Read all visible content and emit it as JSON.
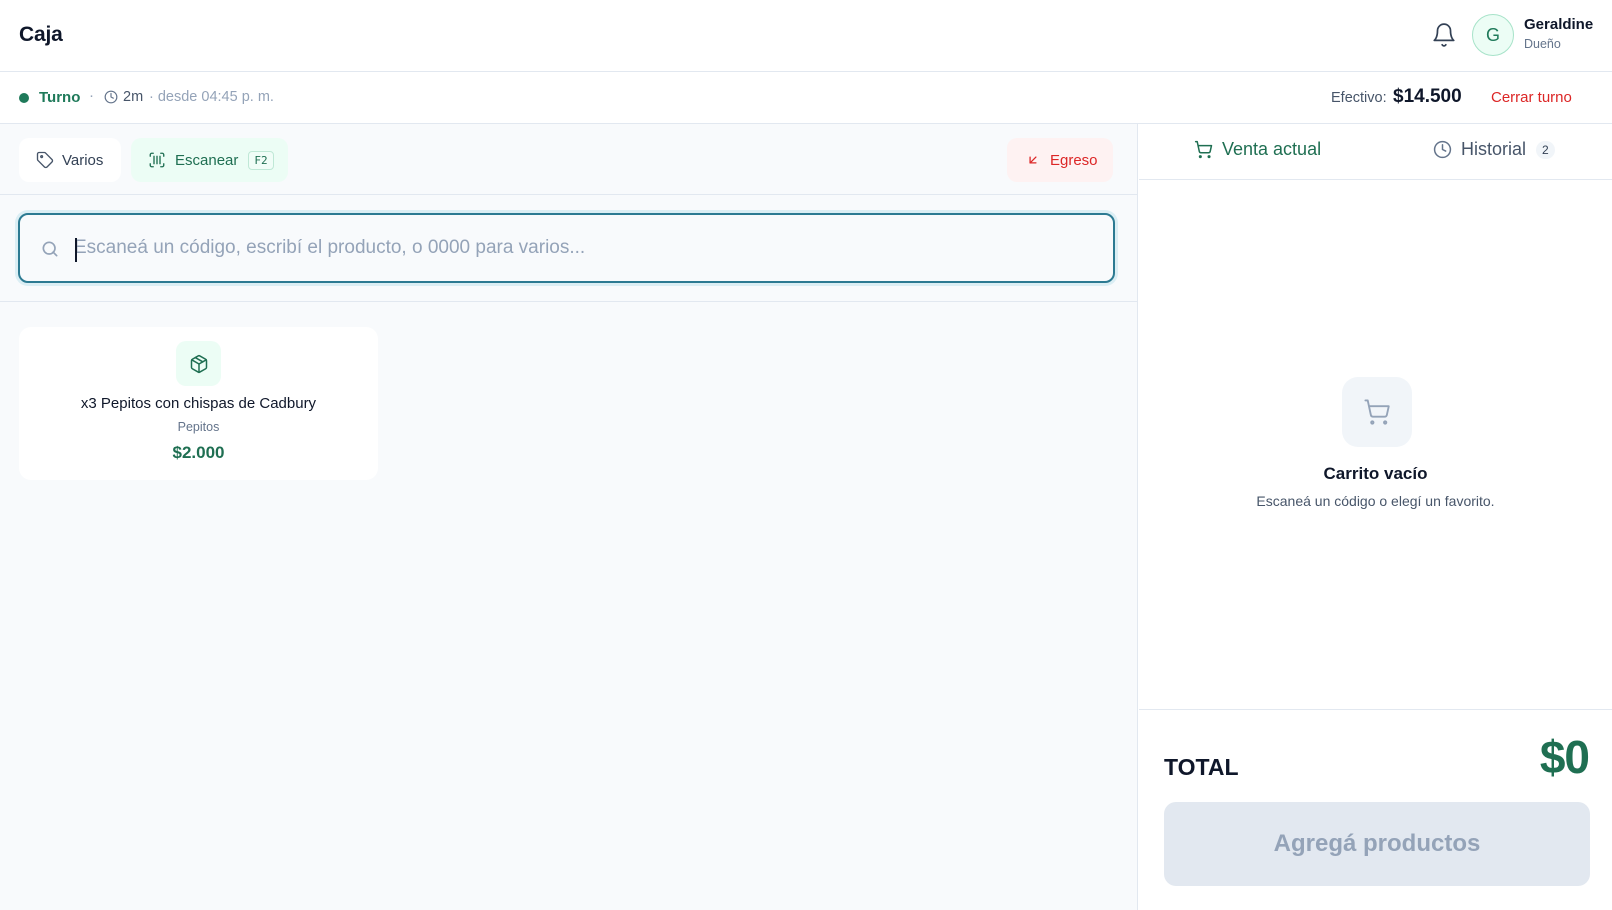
{
  "header": {
    "title": "Caja",
    "user": {
      "initial": "G",
      "name": "Geraldine",
      "role": "Dueño"
    }
  },
  "statusbar": {
    "turno_label": "Turno",
    "separator": "·",
    "elapsed": "2m",
    "since": "· desde 04:45 p. m.",
    "efectivo_label": "Efectivo:",
    "efectivo_value": "$14.500",
    "cerrar_label": "Cerrar turno",
    "status_color": "#1f7a5a"
  },
  "toolbar": {
    "varios_label": "Varios",
    "scan_label": "Escanear",
    "scan_shortcut": "F2",
    "egreso_label": "Egreso"
  },
  "search": {
    "placeholder": "Escaneá un código, escribí el producto, o 0000 para varios...",
    "value": ""
  },
  "products": [
    {
      "name": "x3 Pepitos con chispas de Cadbury",
      "category": "Pepitos",
      "price": "$2.000",
      "icon": "package-icon"
    }
  ],
  "cart": {
    "tabs": [
      {
        "label": "Venta actual",
        "icon": "cart-icon",
        "active": true
      },
      {
        "label": "Historial",
        "icon": "clock-icon",
        "badge": "2",
        "active": false
      }
    ],
    "empty_title": "Carrito vacío",
    "empty_subtitle": "Escaneá un código o elegí un favorito.",
    "total_label": "TOTAL",
    "total_value": "$0",
    "submit_label": "Agregá productos"
  },
  "colors": {
    "brand": "#1f7a5a",
    "danger": "#dc2626",
    "focus": "#2c7a92"
  }
}
